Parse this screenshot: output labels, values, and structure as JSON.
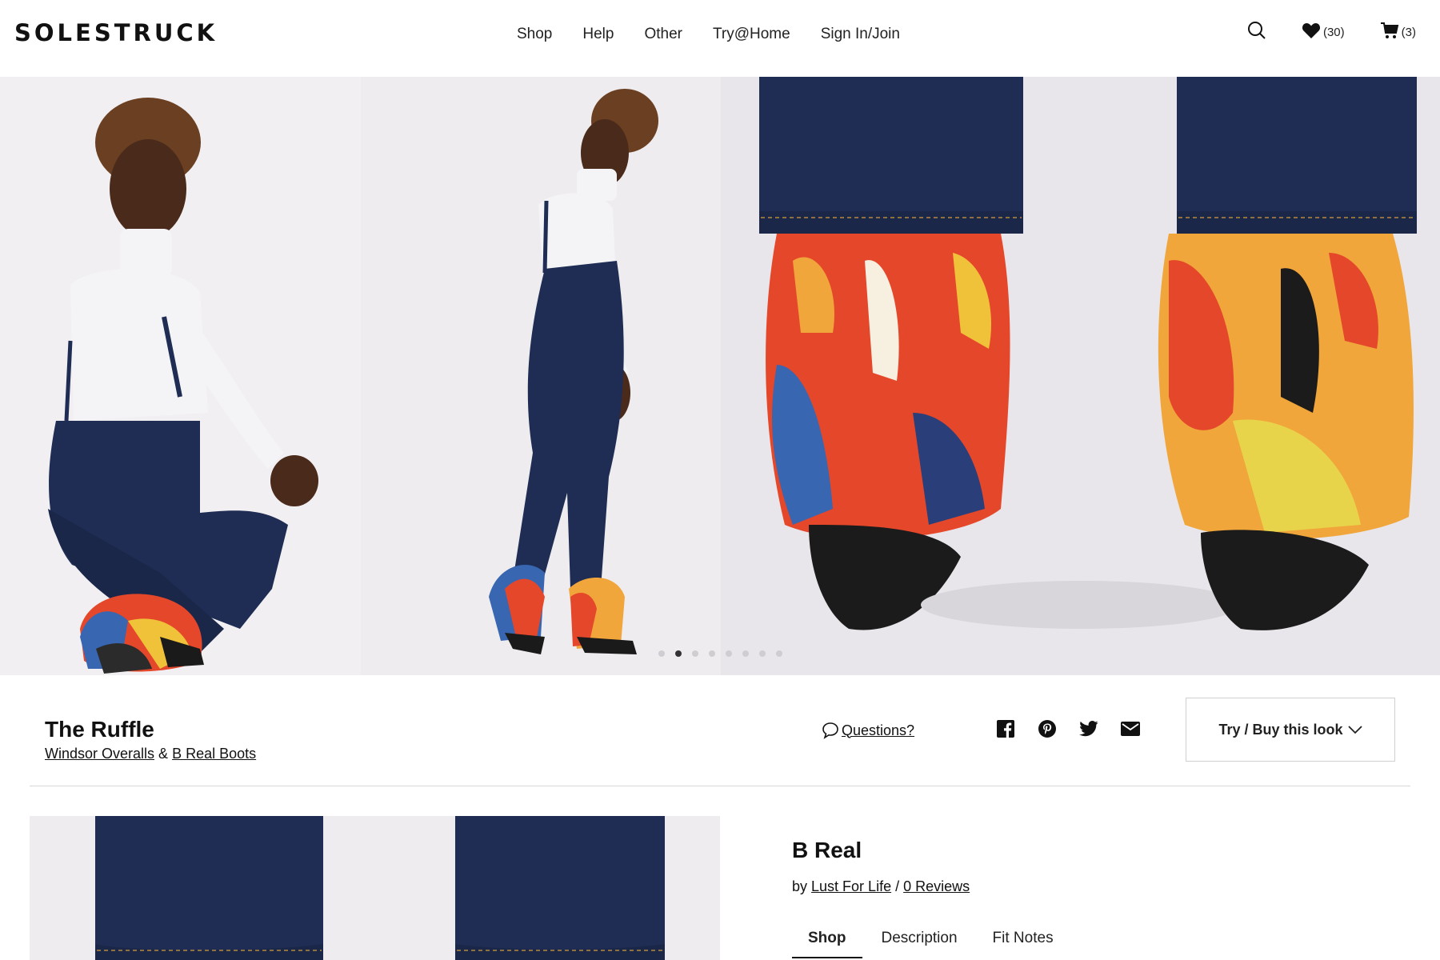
{
  "header": {
    "logo": "SOLESTRUCK",
    "nav": [
      "Shop",
      "Help",
      "Other",
      "Try@Home",
      "Sign In/Join"
    ],
    "wishlist_count": "(30)",
    "cart_count": "(3)"
  },
  "icons": {
    "search": "search-icon",
    "wishlist": "heart-icon",
    "cart": "cart-icon",
    "questions": "speech-bubble-icon",
    "share": [
      "facebook-icon",
      "pinterest-icon",
      "twitter-icon",
      "mail-icon"
    ],
    "dropdown": "chevron-down-icon"
  },
  "carousel": {
    "slide_count": 8,
    "active_index": 1
  },
  "look": {
    "title": "The Ruffle",
    "item1": "Windsor Overalls",
    "separator": "&",
    "item2": "B Real Boots",
    "questions_label": "Questions?",
    "try_buy_label": "Try / Buy this look"
  },
  "product": {
    "name": "B Real",
    "by_prefix": "by",
    "brand": "Lust For Life",
    "slash": "/",
    "reviews": "0 Reviews",
    "tabs": [
      "Shop",
      "Description",
      "Fit Notes"
    ],
    "active_tab": 0
  },
  "colors": {
    "denim": "#1f2d55",
    "background": "#eeecef",
    "text": "#111111"
  }
}
